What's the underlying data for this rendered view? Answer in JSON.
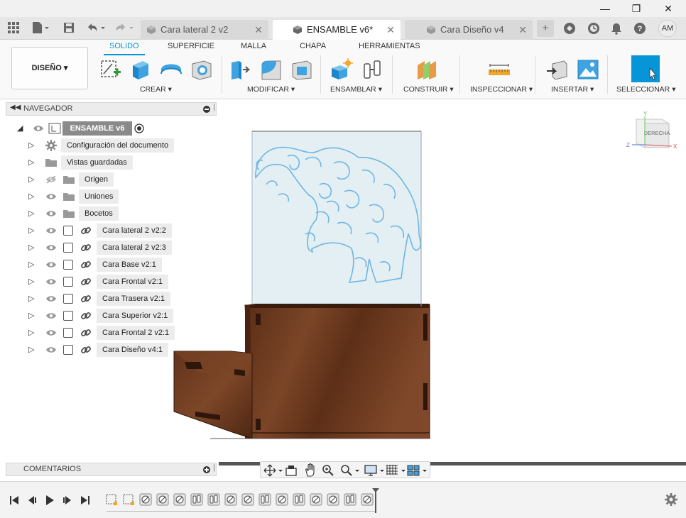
{
  "window": {
    "minimize_icon": "minimize-icon",
    "maximize_icon": "maximize-icon",
    "close_icon": "close-icon"
  },
  "tabs": [
    {
      "label": "Cara lateral 2 v2",
      "active": false
    },
    {
      "label": "ENSAMBLE v6*",
      "active": true
    },
    {
      "label": "Cara Diseño v4",
      "active": false
    }
  ],
  "user": {
    "initials": "AM"
  },
  "workspace": {
    "label": "DISEÑO"
  },
  "ribbon_tabs": [
    "SOLIDO",
    "SUPERFICIE",
    "MALLA",
    "CHAPA",
    "HERRAMIENTAS"
  ],
  "ribbon_groups": [
    "CREAR",
    "MODIFICAR",
    "ENSAMBLAR",
    "CONSTRUIR",
    "INSPECCIONAR",
    "INSERTAR",
    "SELECCIONAR"
  ],
  "navigator": {
    "title": "NAVEGADOR",
    "root": "ENSAMBLE v6",
    "items": [
      {
        "label": "Configuración del documento",
        "kind": "settings"
      },
      {
        "label": "Vistas guardadas",
        "kind": "folder"
      },
      {
        "label": "Origen",
        "kind": "folder-hidden"
      },
      {
        "label": "Uniones",
        "kind": "folder"
      },
      {
        "label": "Bocetos",
        "kind": "folder"
      },
      {
        "label": "Cara lateral 2 v2:2",
        "kind": "component"
      },
      {
        "label": "Cara lateral 2 v2:3",
        "kind": "component"
      },
      {
        "label": "Cara Base v2:1",
        "kind": "component"
      },
      {
        "label": "Cara Frontal v2:1",
        "kind": "component"
      },
      {
        "label": "Cara Trasera v2:1",
        "kind": "component"
      },
      {
        "label": "Cara Superior v2:1",
        "kind": "component"
      },
      {
        "label": "Cara Frontal 2 v2:1",
        "kind": "component"
      },
      {
        "label": "Cara Diseño v4:1",
        "kind": "component"
      }
    ]
  },
  "comments": {
    "title": "COMENTARIOS"
  },
  "viewcube": {
    "face": "DERECHA",
    "axis_y": "Y",
    "axis_z": "Z",
    "axis_x": "X"
  },
  "colors": {
    "accent": "#0696d7",
    "wood": "#6b3a1f",
    "glass": "#e8f2f6",
    "engraving": "#6fb6e3"
  }
}
